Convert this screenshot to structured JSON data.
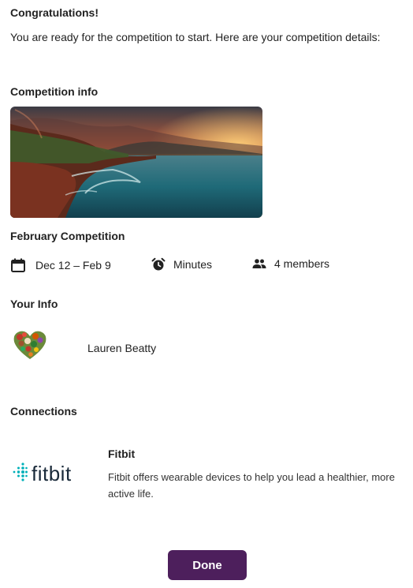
{
  "header": {
    "title": "Congratulations!",
    "message": "You are ready for the competition to start. Here are your competition details:"
  },
  "competition": {
    "section_title": "Competition info",
    "name": "February Competition",
    "dates": "Dec 12 – Feb 9",
    "metric": "Minutes",
    "members": "4 members"
  },
  "your_info": {
    "section_title": "Your Info",
    "user_name": "Lauren Beatty"
  },
  "connections": {
    "section_title": "Connections",
    "items": [
      {
        "logo_text": "fitbit",
        "name": "Fitbit",
        "description": "Fitbit offers wearable devices to help you lead a healthier, more active life."
      }
    ]
  },
  "actions": {
    "done_label": "Done"
  },
  "colors": {
    "primary": "#4d1f5c",
    "fitbit_teal": "#00b0b9"
  },
  "icons": {
    "dates": "calendar-icon",
    "metric": "alarm-clock-icon",
    "members": "people-icon"
  }
}
